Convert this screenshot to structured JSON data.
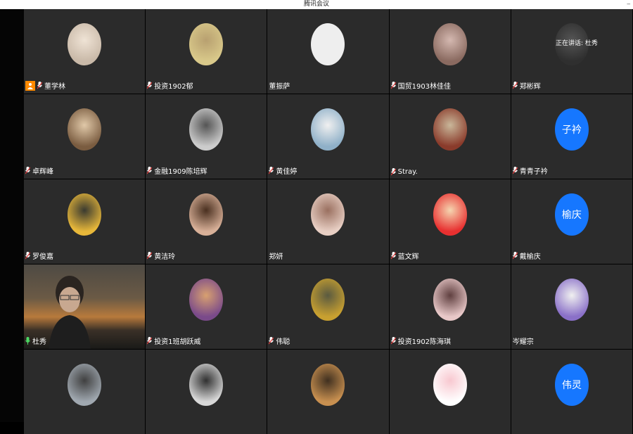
{
  "window": {
    "title": "腾讯会议"
  },
  "speaking_indicator": "正在讲话: 杜秀",
  "participants": [
    {
      "name": "董学林",
      "host": true,
      "avatar": "photo-baby",
      "avatar_colors": [
        "#c9b9a8",
        "#efe3d5"
      ]
    },
    {
      "name": "投资1902郁",
      "avatar": "photo-cartoon",
      "avatar_colors": [
        "#d9c98a",
        "#b8a070"
      ]
    },
    {
      "name": "董振萨",
      "avatar": "blank",
      "avatar_colors": [
        "#eeeeee",
        "#eeeeee"
      ]
    },
    {
      "name": "国贸1903林佳佳",
      "avatar": "photo-girl",
      "avatar_colors": [
        "#8a6a60",
        "#d4b8b0"
      ]
    },
    {
      "name": "郑彬辉",
      "avatar": "photo-dark",
      "avatar_colors": [
        "#2f2f2f",
        "#555555"
      ]
    },
    {
      "name": "卓辉峰",
      "avatar": "photo-girl-sitting",
      "avatar_colors": [
        "#7a5c40",
        "#e0c8a8"
      ]
    },
    {
      "name": "金融1909陈培辉",
      "avatar": "photo-man",
      "avatar_colors": [
        "#cccccc",
        "#555555"
      ]
    },
    {
      "name": "黄佳婷",
      "avatar": "photo-cartoon-animal",
      "avatar_colors": [
        "#8fb0c8",
        "#f0f0f0"
      ]
    },
    {
      "name": "Stray.",
      "avatar": "photo-street",
      "avatar_colors": [
        "#8a3b2b",
        "#c9b79a"
      ]
    },
    {
      "name": "青青子衿",
      "avatar_text": "子衿",
      "avatar": "text"
    },
    {
      "name": "罗俊嘉",
      "avatar": "photo-yellow-hood",
      "avatar_colors": [
        "#e8b83a",
        "#3a3a30"
      ]
    },
    {
      "name": "黄洁玲",
      "avatar": "photo-woman",
      "avatar_colors": [
        "#d8b098",
        "#4a3020"
      ]
    },
    {
      "name": "郑妍",
      "avatar": "photo-girl-face",
      "avatar_colors": [
        "#e8cfc4",
        "#9a7060"
      ]
    },
    {
      "name": "蓝文辉",
      "avatar": "photo-crayon",
      "avatar_colors": [
        "#e83030",
        "#f5d5b0"
      ]
    },
    {
      "name": "戴榆庆",
      "avatar_text": "榆庆",
      "avatar": "text"
    },
    {
      "name": "杜秀",
      "video": true,
      "active": true
    },
    {
      "name": "投资1班胡跃威",
      "avatar": "photo-group",
      "avatar_colors": [
        "#7a4a8a",
        "#d8a070"
      ]
    },
    {
      "name": "伟聪",
      "avatar": "photo-gold",
      "avatar_colors": [
        "#c8a030",
        "#5a5a40"
      ]
    },
    {
      "name": "投资1902陈海琪",
      "avatar": "photo-woman-pink",
      "avatar_colors": [
        "#e8c8c8",
        "#604040"
      ]
    },
    {
      "name": "岑耀宗",
      "no_mic": true,
      "avatar": "photo-anime-wolf",
      "avatar_colors": [
        "#8a70c8",
        "#f0f0f0"
      ]
    },
    {
      "name": "",
      "avatar": "photo-landscape",
      "avatar_colors": [
        "#a0a8b0",
        "#404040"
      ]
    },
    {
      "name": "",
      "avatar": "photo-bw-man",
      "avatar_colors": [
        "#d8d8d8",
        "#303030"
      ]
    },
    {
      "name": "",
      "avatar": "photo-warrior",
      "avatar_colors": [
        "#c89050",
        "#403020"
      ]
    },
    {
      "name": "",
      "avatar": "photo-pink-cartoon",
      "avatar_colors": [
        "#ffffff",
        "#f8c8d0"
      ]
    },
    {
      "name": "",
      "avatar_text": "伟灵",
      "avatar": "text"
    }
  ],
  "colors": {
    "tile_bg": "#2b2b2b",
    "host_badge": "#ff8a00",
    "text_avatar": "#1677ff",
    "active_border": "#3ecf5a"
  }
}
